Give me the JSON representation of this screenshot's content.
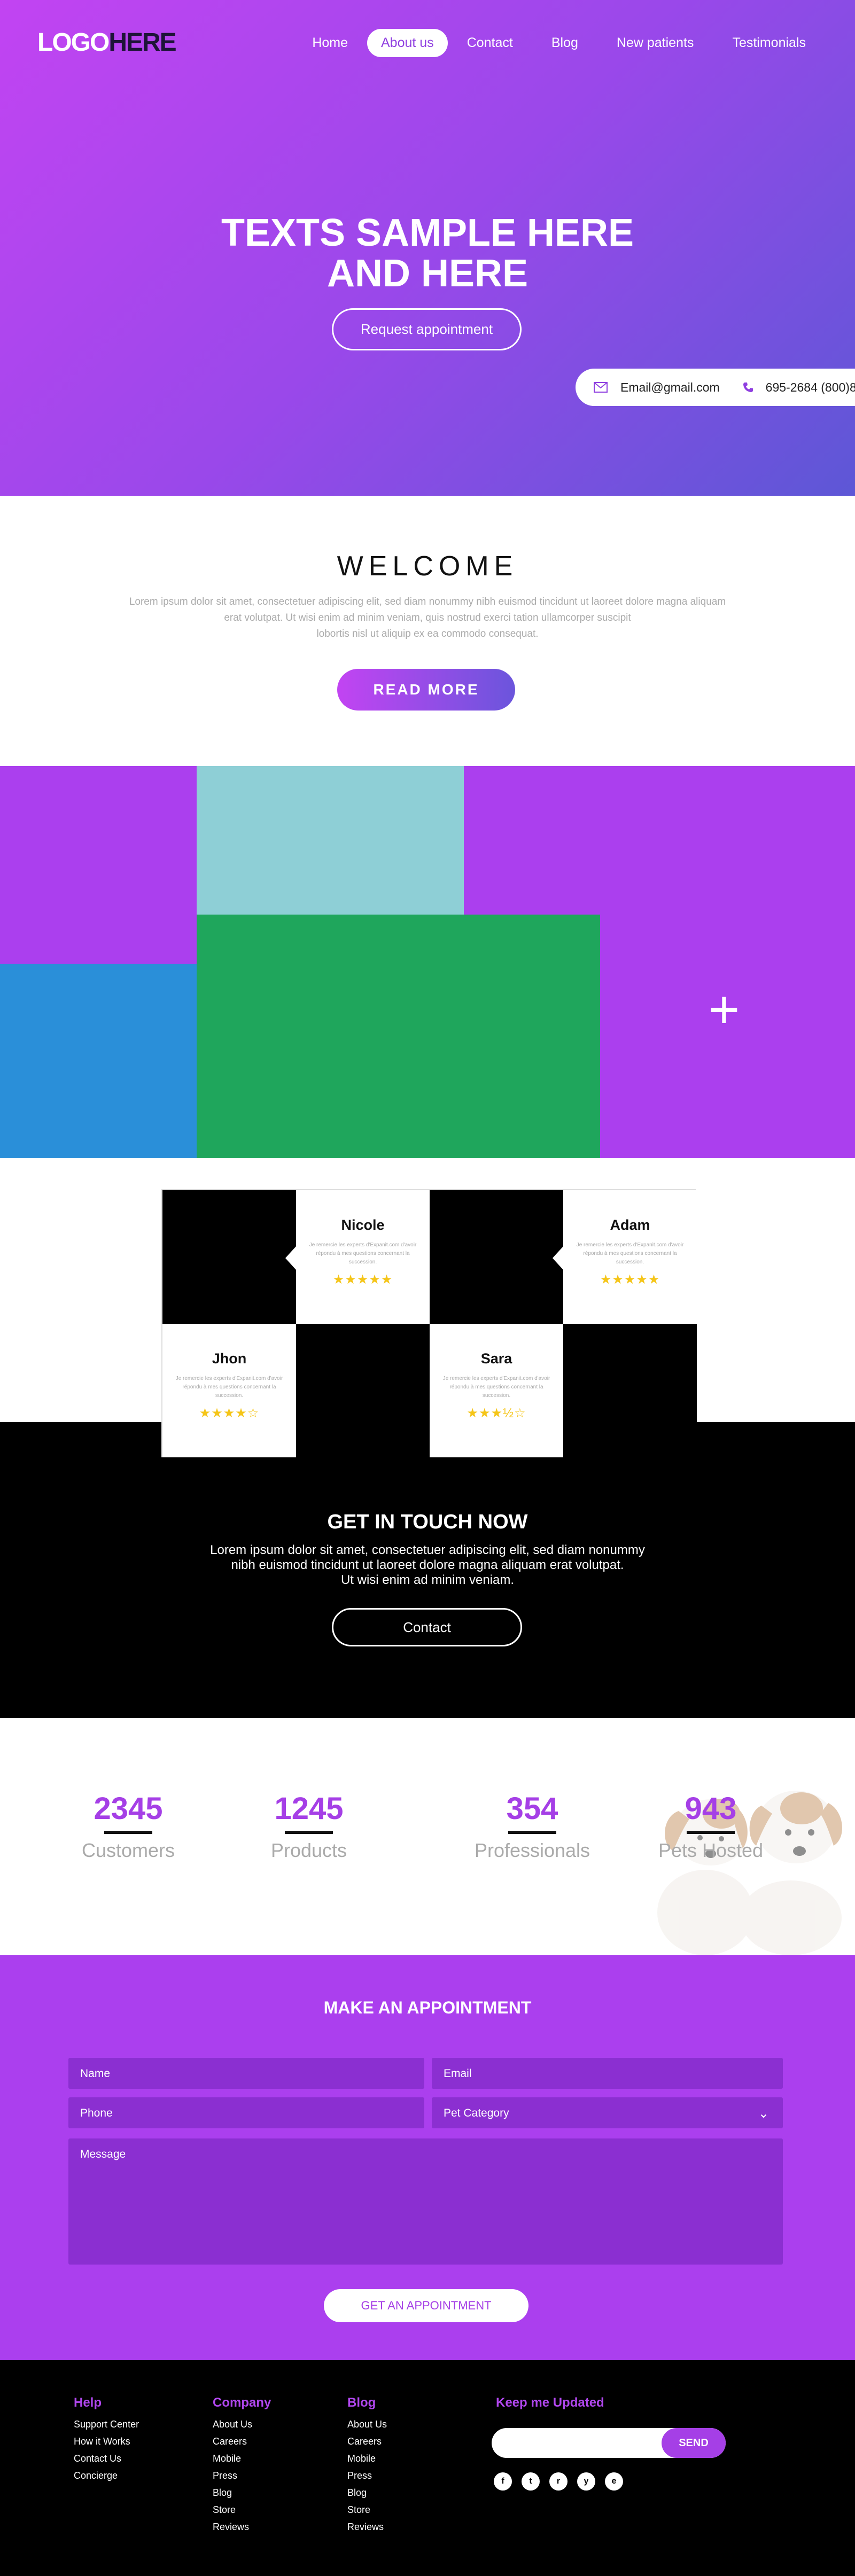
{
  "header": {
    "logo_part1": "LOGO",
    "logo_part2": "HERE",
    "nav": [
      "Home",
      "About us",
      "Contact",
      "Blog",
      "New patients",
      "Testimonials"
    ],
    "active_nav": "About us"
  },
  "hero": {
    "title_line1": "TEXTS SAMPLE HERE",
    "title_line2": "AND HERE",
    "button": "Request appointment",
    "email": "Email@gmail.com",
    "phone": "695-2684 (800)8",
    "email_icon": "envelope-icon",
    "phone_icon": "phone-icon"
  },
  "welcome": {
    "title": "WELCOME",
    "text_line1": "Lorem ipsum dolor sit amet, consectetuer adipiscing elit, sed diam nonummy nibh euismod tincidunt ut laoreet dolore magna aliquam",
    "text_line2": "erat volutpat. Ut wisi enim ad minim veniam, quis nostrud exerci tation ullamcorper suscipit",
    "text_line3": "lobortis nisl ut aliquip ex ea commodo consequat.",
    "button": "READ MORE"
  },
  "mosaic": {
    "colors": {
      "purple": "#ab3fee",
      "teal": "#8ecfd6",
      "blue": "#2a8fd9",
      "green": "#1fa65c"
    },
    "plus_icon": "plus-icon"
  },
  "testimonials": [
    {
      "name": "Nicole",
      "text": "Je remercie les experts d'Expanit.com d'avoir répondu à mes questions concernant la succession.",
      "stars": "★★★★★",
      "rating": 5
    },
    {
      "name": "Adam",
      "text": "Je remercie les experts d'Expanit.com d'avoir répondu à mes questions concernant la succession.",
      "stars": "★★★★★",
      "rating": 5
    },
    {
      "name": "Jhon",
      "text": "Je remercie les experts d'Expanit.com d'avoir répondu à mes questions concernant la succession.",
      "stars": "★★★★☆",
      "rating": 4
    },
    {
      "name": "Sara",
      "text": "Je remercie les experts d'Expanit.com d'avoir répondu à mes questions concernant la succession.",
      "stars": "★★★½☆",
      "rating": 3.5
    }
  ],
  "get_in_touch": {
    "title": "GET IN TOUCH NOW",
    "line1": "Lorem ipsum dolor sit amet, consectetuer adipiscing elit, sed diam nonummy",
    "line2": "nibh euismod tincidunt ut laoreet dolore magna aliquam erat volutpat.",
    "line3": "Ut wisi enim ad minim veniam.",
    "button": "Contact"
  },
  "stats": [
    {
      "num": "2345",
      "label": "Customers"
    },
    {
      "num": "1245",
      "label": "Products"
    },
    {
      "num": "354",
      "label": "Professionals"
    },
    {
      "num": "943",
      "label": "Pets Hosted"
    }
  ],
  "appointment": {
    "title": "MAKE AN APPOINTMENT",
    "name_ph": "Name",
    "email_ph": "Email",
    "phone_ph": "Phone",
    "pet_ph": "Pet Category",
    "message_ph": "Message",
    "button": "GET AN APPOINTMENT",
    "chevron_icon": "chevron-down-icon"
  },
  "footer": {
    "help": {
      "title": "Help",
      "items": [
        "Support Center",
        "How it Works",
        "Contact Us",
        "Concierge"
      ]
    },
    "company": {
      "title": "Company",
      "items": [
        "About Us",
        "Careers",
        "Mobile",
        "Press",
        "Blog",
        "Store",
        "Reviews"
      ]
    },
    "blog": {
      "title": "Blog",
      "items": [
        "About Us",
        "Careers",
        "Mobile",
        "Press",
        "Blog",
        "Store",
        "Reviews"
      ]
    },
    "newsletter_title": "Keep me Updated",
    "send": "SEND",
    "socials": [
      {
        "icon": "facebook-icon",
        "glyph": "f"
      },
      {
        "icon": "twitter-icon",
        "glyph": "t"
      },
      {
        "icon": "rss-icon",
        "glyph": "r"
      },
      {
        "icon": "yelp-icon",
        "glyph": "y"
      },
      {
        "icon": "etsy-icon",
        "glyph": "e"
      }
    ]
  }
}
